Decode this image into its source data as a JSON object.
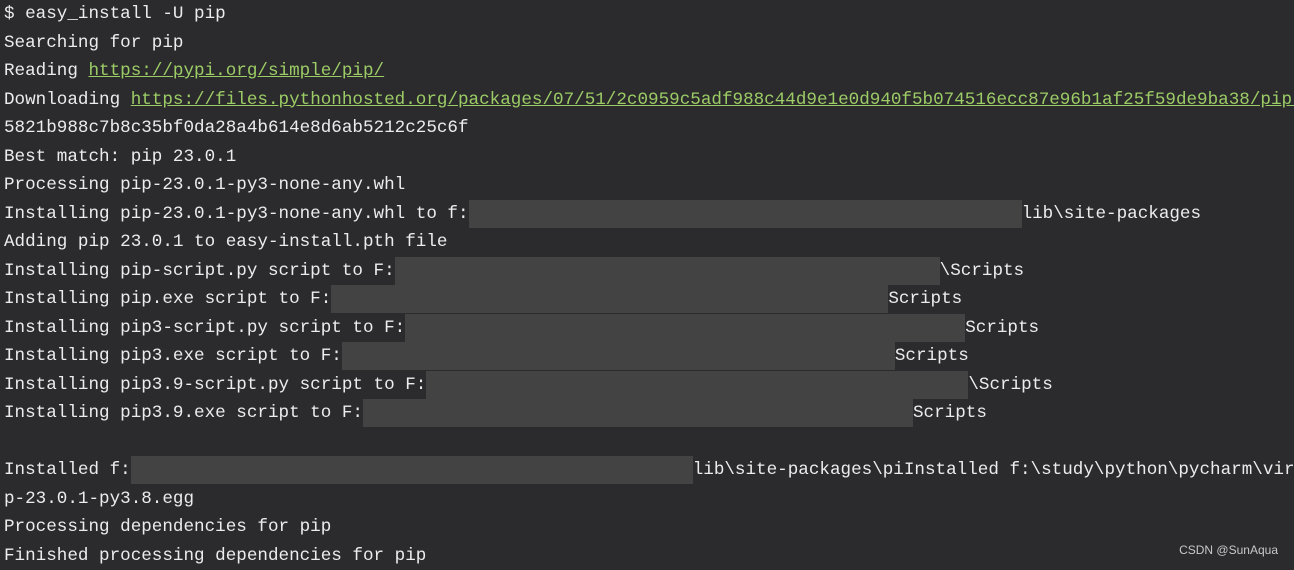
{
  "terminal": {
    "command": "$ easy_install -U pip",
    "searching": "Searching for pip",
    "reading_label": "Reading ",
    "reading_url": "https://pypi.org/simple/pip/",
    "downloading_label": "Downloading ",
    "downloading_url": "https://files.pythonhosted.org/packages/07/51/2c0959c5adf988c44d9e1e0d940f5b074516ecc87e96b1af25f59de9ba38/pip-",
    "hash": "5821b988c7b8c35bf0da28a4b614e8d6ab5212c25c6f",
    "best_match": "Best match: pip 23.0.1",
    "processing": "Processing pip-23.0.1-py3-none-any.whl",
    "installing_whl_prefix": "Installing pip-23.0.1-py3-none-any.whl to f:",
    "installing_whl_suffix": "lib\\site-packages",
    "adding": "Adding pip 23.0.1 to easy-install.pth file",
    "scripts": [
      {
        "prefix": "Installing pip-script.py script to F:",
        "suffix": "\\Scripts"
      },
      {
        "prefix": "Installing pip.exe script to F:",
        "suffix": "Scripts"
      },
      {
        "prefix": "Installing pip3-script.py script to F:",
        "suffix": "Scripts"
      },
      {
        "prefix": "Installing pip3.exe script to F:",
        "suffix": "Scripts"
      },
      {
        "prefix": "Installing pip3.9-script.py script to F:",
        "suffix": "\\Scripts"
      },
      {
        "prefix": "Installing pip3.9.exe script to F:",
        "suffix": "Scripts"
      }
    ],
    "installed_prefix": "Installed f:",
    "installed_suffix": "lib\\site-packages\\piInstalled f:\\study\\python\\pycharm\\virt",
    "egg": "p-23.0.1-py3.8.egg",
    "processing_deps": "Processing dependencies for pip",
    "finished_deps": "Finished processing dependencies for pip"
  },
  "watermark": "CSDN @SunAqua",
  "colors": {
    "background": "#2b2a2d",
    "text": "#ececec",
    "link": "#9ccc65",
    "redaction": "#434343"
  }
}
